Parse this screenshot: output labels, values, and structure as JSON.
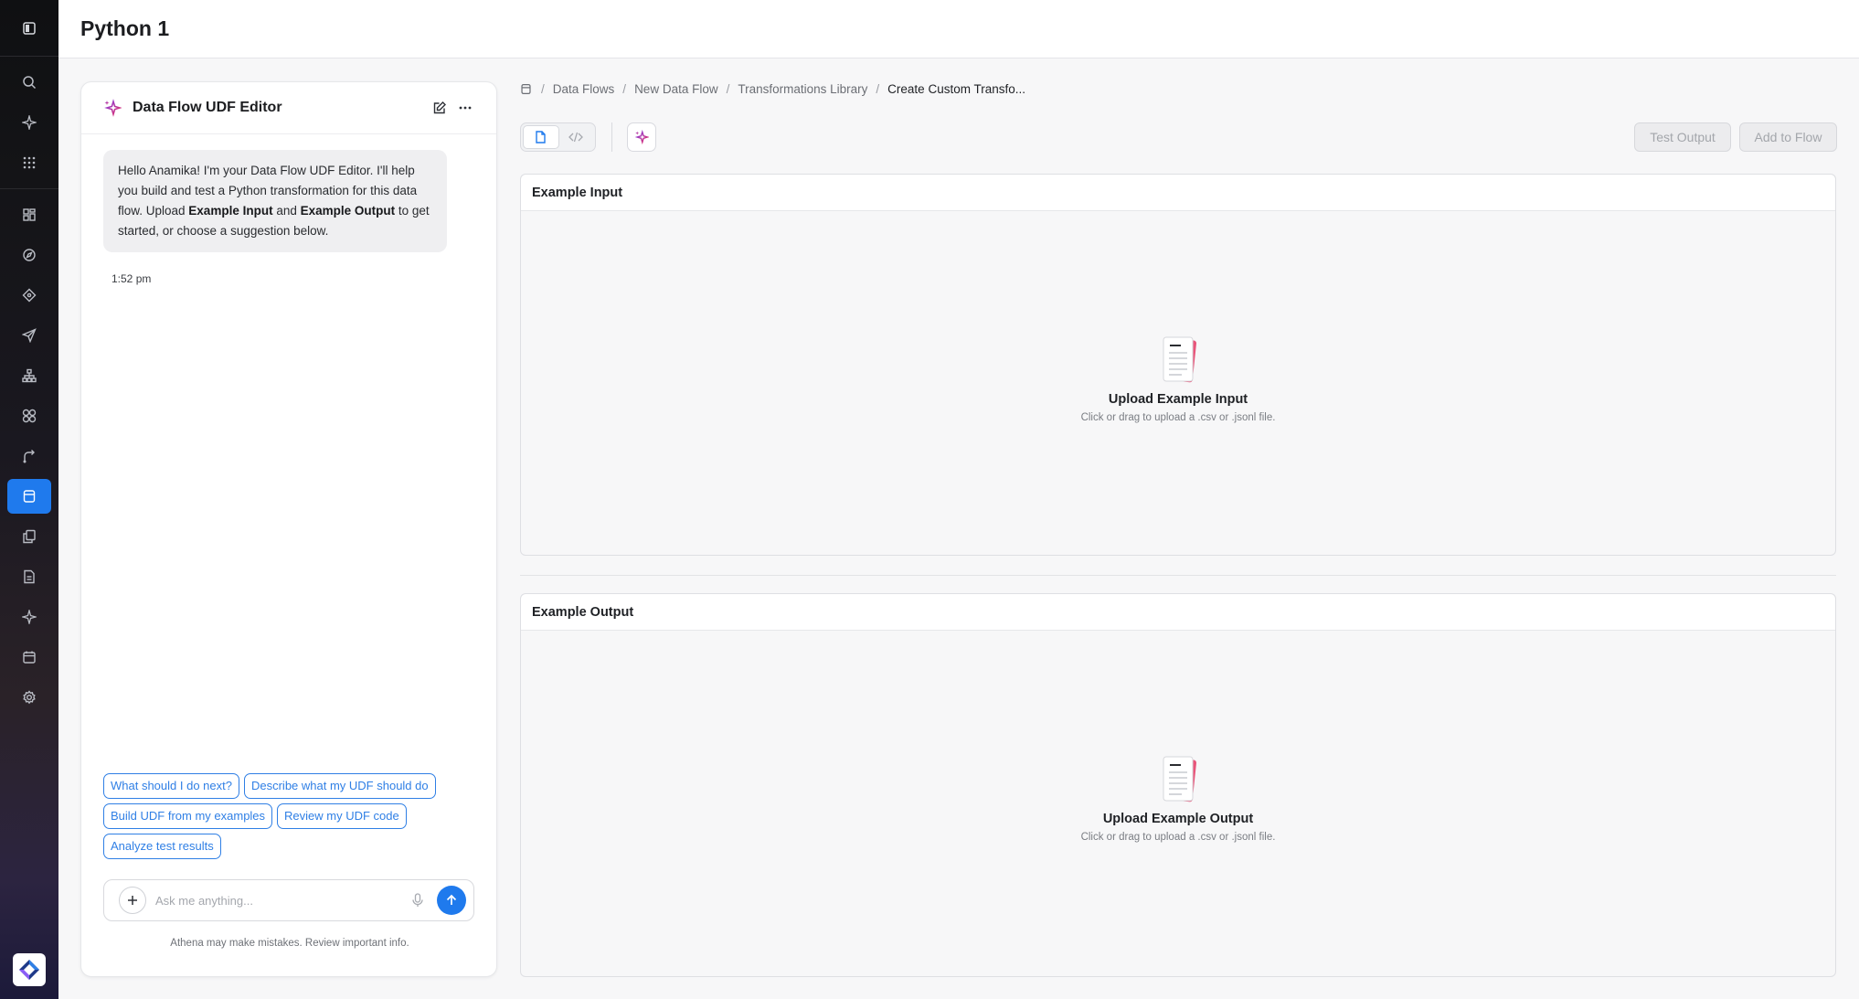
{
  "header": {
    "title": "Python 1"
  },
  "chat": {
    "title": "Data Flow UDF Editor",
    "message": {
      "part1": "Hello Anamika! I'm your Data Flow UDF Editor. I'll help you build and test a Python transformation for this data flow. Upload ",
      "bold1": "Example Input",
      "part2": " and ",
      "bold2": "Example Output",
      "part3": " to get started, or choose a suggestion below."
    },
    "time": "1:52 pm",
    "suggestions": [
      "What should I do next?",
      "Describe what my UDF should do",
      "Build UDF from my examples",
      "Review my UDF code",
      "Analyze test results"
    ],
    "input_placeholder": "Ask me anything...",
    "disclaimer": "Athena may make mistakes. Review important info."
  },
  "breadcrumb": [
    "Data Flows",
    "New Data Flow",
    "Transformations Library",
    "Create Custom Transfo..."
  ],
  "toolbar": {
    "test_label": "Test Output",
    "add_label": "Add to Flow"
  },
  "input_panel": {
    "title": "Example Input",
    "upload_title": "Upload Example Input",
    "upload_sub": "Click or drag to upload a .csv or .jsonl file."
  },
  "output_panel": {
    "title": "Example Output",
    "upload_title": "Upload Example Output",
    "upload_sub": "Click or drag to upload a .csv or .jsonl file."
  },
  "colors": {
    "accent": "#1f7aed",
    "rail_active": "#1f7aed"
  },
  "rail_icons": [
    "panel-toggle-icon",
    "search-icon",
    "sparkle-icon",
    "apps-grid-icon",
    "dashboard-icon",
    "compass-icon",
    "diamond-icon",
    "send-icon",
    "hierarchy-icon",
    "shapes-icon",
    "route-icon",
    "database-icon",
    "documents-icon",
    "file-icon",
    "ai-sparkle-icon",
    "calendar-icon",
    "settings-icon"
  ]
}
